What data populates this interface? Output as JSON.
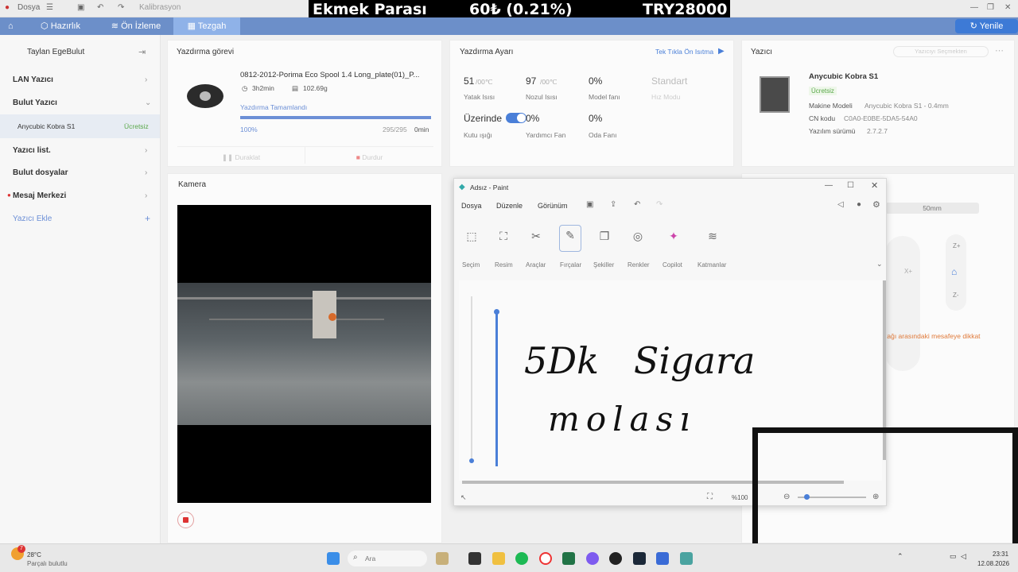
{
  "topbar": {
    "menu": "Dosya",
    "calibration": "Kalibrasyon"
  },
  "overlay": {
    "item": "Ekmek Parası",
    "price": "60₺ (0.21%)",
    "total": "TRY28000"
  },
  "tabs": [
    {
      "label": "Hazırlık"
    },
    {
      "label": "Ön İzleme"
    },
    {
      "label": "Tezgah"
    }
  ],
  "refresh_label": "Yenile",
  "sidebar": {
    "user": "Taylan EgeBulut",
    "items": [
      {
        "label": "LAN Yazıcı"
      },
      {
        "label": "Bulut Yazıcı"
      },
      {
        "label": "Yazıcı list."
      },
      {
        "label": "Bulut dosyalar"
      },
      {
        "label": "Mesaj Merkezi"
      },
      {
        "label": "Yazıcı Ekle"
      }
    ],
    "printer": {
      "name": "Anycubic Kobra S1",
      "badge": "Ücretsiz"
    }
  },
  "print_task": {
    "title": "Yazdırma görevi",
    "file": "0812-2012-Porima Eco Spool 1.4 Long_plate(01)_P...",
    "time": "3h2min",
    "weight": "102.69g",
    "status": "Yazdırma Tamamlandı",
    "percent_label": "100%",
    "progress": 1.0,
    "layers": "295/295",
    "remaining": "0min",
    "pause": "Duraklat",
    "stop": "Durdur"
  },
  "print_settings": {
    "title": "Yazdırma Ayarı",
    "preheat": "Tek Tıkla Ön Isıtma",
    "bed": {
      "value": "51",
      "target": "/00℃",
      "label": "Yatak Isısı"
    },
    "nozzle": {
      "value": "97",
      "target": "/00℃",
      "label": "Nozul Isısı"
    },
    "model_fan": {
      "value": "0%",
      "label": "Model fanı"
    },
    "speed": {
      "value": "Standart",
      "label": "Hız Modu"
    },
    "box_light": {
      "value": "Üzerinde",
      "label": "Kutu ışığı"
    },
    "aux_fan": {
      "value": "0%",
      "label": "Yardımcı Fan"
    },
    "room_fan": {
      "value": "0%",
      "label": "Oda Fanı"
    }
  },
  "printer_card": {
    "title": "Yazıcı",
    "switch": "Yazıcıyı Seçmekten",
    "name": "Anycubic Kobra S1",
    "badge": "Ücretsiz",
    "model_label": "Makine Modeli",
    "model_value": "Anycubic Kobra S1 - 0.4mm",
    "cn_label": "CN kodu",
    "cn_value": "C0A0-E0BE-5DA5-54A0",
    "fw_label": "Yazılım sürümü",
    "fw_value": "2.7.2.7"
  },
  "camera": {
    "title": "Kamera"
  },
  "control": {
    "step": "50mm",
    "z_up": "Z+",
    "z_down": "Z-",
    "x_plus": "X+",
    "warning": "tağı arasındaki mesafeye dikkat"
  },
  "paint": {
    "title": "Adsız - Paint",
    "menu": [
      "Dosya",
      "Düzenle",
      "Görünüm"
    ],
    "tools": [
      "Seçim",
      "Resim",
      "Araçlar",
      "Fırçalar",
      "Şekiller",
      "Renkler",
      "Copilot",
      "Katmanlar"
    ],
    "handwriting_line1": "5Dk   Sigara",
    "handwriting_line2": "molası",
    "zoom": "%100"
  },
  "taskbar": {
    "weather_badge": "7",
    "temp": "28°C",
    "weather": "Parçalı bulutlu",
    "search": "Ara",
    "time": "23:31",
    "date": "12.08.2026"
  }
}
